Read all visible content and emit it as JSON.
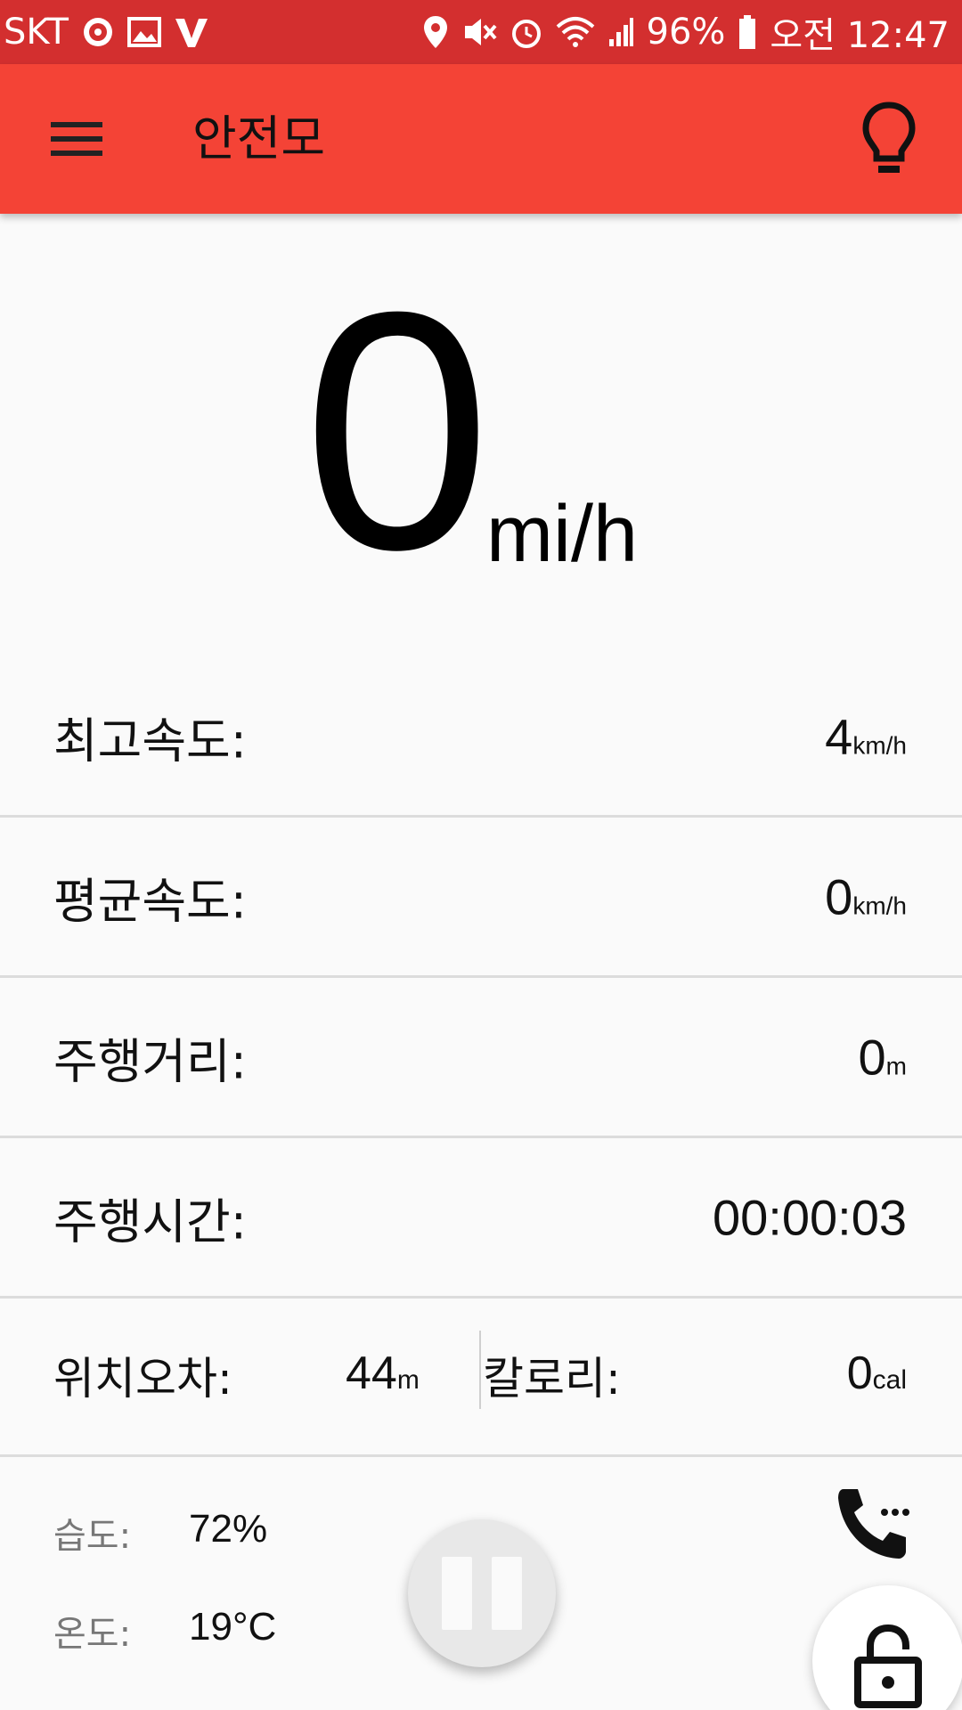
{
  "status_bar": {
    "carrier": "SKT",
    "battery": "96%",
    "time": "오전 12:47",
    "icons": [
      "badge-icon",
      "image-icon",
      "v3-icon",
      "location-icon",
      "mute-icon",
      "alarm-icon",
      "wifi-icon",
      "signal-icon",
      "battery-icon"
    ]
  },
  "app_bar": {
    "title": "안전모",
    "left_icon": "menu-icon",
    "right_icon": "lightbulb-icon"
  },
  "speed": {
    "value": "0",
    "unit": "mi/h"
  },
  "stats": [
    {
      "label": "최고속도:",
      "value": "4",
      "unit": "km/h"
    },
    {
      "label": "평균속도:",
      "value": "0",
      "unit": "km/h"
    },
    {
      "label": "주행거리:",
      "value": "0",
      "unit": "m"
    },
    {
      "label": "주행시간:",
      "value": "00:00:03",
      "unit": ""
    }
  ],
  "split": {
    "left": {
      "label": "위치오차:",
      "value": "44",
      "unit": "m"
    },
    "right": {
      "label": "칼로리:",
      "value": "0",
      "unit": "cal"
    }
  },
  "env": {
    "humidity_label": "습도:",
    "humidity_value": "72%",
    "temperature_label": "온도:",
    "temperature_value": "19°C"
  },
  "controls": {
    "pause_icon": "pause-icon",
    "phone_icon": "phone-icon",
    "lock_icon": "unlock-icon"
  },
  "colors": {
    "status_bar": "#d32f2f",
    "app_bar": "#f44336",
    "background": "#fafafa"
  }
}
